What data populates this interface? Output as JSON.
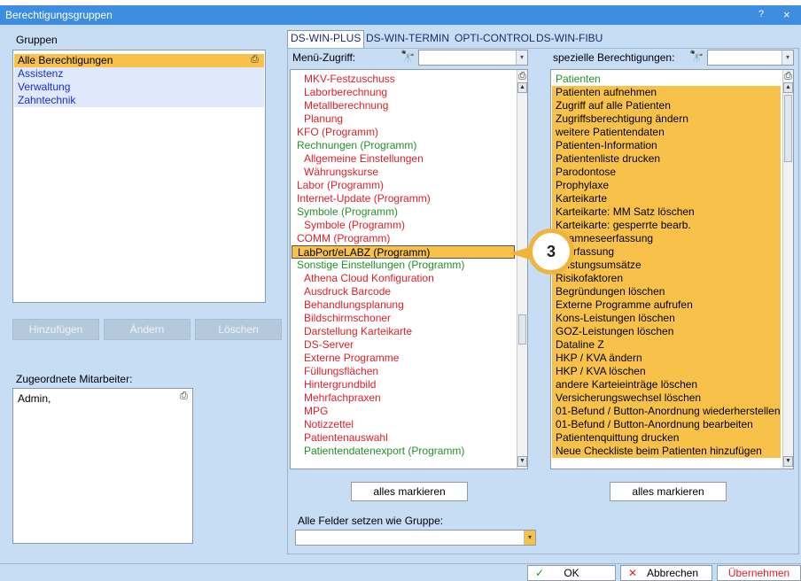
{
  "window": {
    "title": "Berechtigungsgruppen",
    "help": "?",
    "close": "×"
  },
  "groups": {
    "label": "Gruppen",
    "items": [
      "Alle Berechtigungen",
      "Assistenz",
      "Verwaltung",
      "Zahntechnik"
    ],
    "buttons": {
      "add": "Hinzufügen",
      "edit": "Ändern",
      "delete": "Löschen"
    }
  },
  "employees": {
    "label": "Zugeordnete Mitarbeiter:",
    "items": [
      "Admin,"
    ]
  },
  "tabs": [
    "DS-WIN-PLUS",
    "DS-WIN-TERMIN",
    "OPTI-CONTROL",
    "DS-WIN-FIBU"
  ],
  "menu_access": {
    "label": "Menü-Zugriff:",
    "search_value": "",
    "items": [
      {
        "text": "MKV-Festzuschuss",
        "color": "red",
        "indent": true
      },
      {
        "text": "Laborberechnung",
        "color": "red",
        "indent": true
      },
      {
        "text": "Metallberechnung",
        "color": "red",
        "indent": true
      },
      {
        "text": "Planung",
        "color": "red",
        "indent": true
      },
      {
        "text": "KFO (Programm)",
        "color": "red",
        "indent": false
      },
      {
        "text": "Rechnungen (Programm)",
        "color": "green",
        "indent": false
      },
      {
        "text": "Allgemeine Einstellungen",
        "color": "red",
        "indent": true
      },
      {
        "text": "Währungskurse",
        "color": "red",
        "indent": true
      },
      {
        "text": "Labor (Programm)",
        "color": "red",
        "indent": false
      },
      {
        "text": "Internet-Update (Programm)",
        "color": "red",
        "indent": false
      },
      {
        "text": "Symbole (Programm)",
        "color": "green",
        "indent": false
      },
      {
        "text": "Symbole (Programm)",
        "color": "red",
        "indent": true
      },
      {
        "text": "COMM (Programm)",
        "color": "red",
        "indent": false
      },
      {
        "text": "LabPort/eLABZ (Programm)",
        "color": "black",
        "indent": false,
        "selected": true
      },
      {
        "text": "Sonstige Einstellungen (Programm)",
        "color": "green",
        "indent": false
      },
      {
        "text": "Athena Cloud Konfiguration",
        "color": "red",
        "indent": true
      },
      {
        "text": "Ausdruck Barcode",
        "color": "red",
        "indent": true
      },
      {
        "text": "Behandlungsplanung",
        "color": "red",
        "indent": true
      },
      {
        "text": "Bildschirmschoner",
        "color": "red",
        "indent": true
      },
      {
        "text": "Darstellung Karteikarte",
        "color": "red",
        "indent": true
      },
      {
        "text": "DS-Server",
        "color": "red",
        "indent": true
      },
      {
        "text": "Externe Programme",
        "color": "red",
        "indent": true
      },
      {
        "text": "Füllungsflächen",
        "color": "red",
        "indent": true
      },
      {
        "text": "Hintergrundbild",
        "color": "red",
        "indent": true
      },
      {
        "text": "Mehrfachpraxen",
        "color": "red",
        "indent": true
      },
      {
        "text": "MPG",
        "color": "red",
        "indent": true
      },
      {
        "text": "Notizzettel",
        "color": "red",
        "indent": true
      },
      {
        "text": "Patientenauswahl",
        "color": "red",
        "indent": true
      },
      {
        "text": "Patientendatenexport (Programm)",
        "color": "green",
        "indent": true
      }
    ],
    "mark_all": "alles markieren"
  },
  "special_rights": {
    "label": "spezielle Berechtigungen:",
    "search_value": "",
    "header": "Patienten",
    "items": [
      "Patienten aufnehmen",
      "Zugriff auf alle Patienten",
      "Zugriffsberechtigung ändern",
      "weitere Patientendaten",
      "Patienten-Information",
      "Patientenliste drucken",
      "Parodontose",
      "Prophylaxe",
      "Karteikarte",
      "Karteikarte: MM Satz löschen",
      "Karteikarte: gesperrte bearb.",
      "Anamneseerfassung",
      "Leerfassung",
      "Leistungsumsätze",
      "Risikofaktoren",
      "Begründungen löschen",
      "Externe Programme aufrufen",
      "Kons-Leistungen löschen",
      "GOZ-Leistungen löschen",
      "Dataline Z",
      "HKP / KVA ändern",
      "HKP / KVA löschen",
      "andere Karteieinträge löschen",
      "Versicherungswechsel löschen",
      "01-Befund / Button-Anordnung wiederherstellen",
      "01-Befund / Button-Anordnung bearbeiten",
      "Patientenquittung drucken",
      "Neue Checkliste beim Patienten hinzufügen"
    ],
    "mark_all": "alles markieren"
  },
  "set_all": {
    "label": "Alle Felder setzen wie Gruppe:",
    "value": ""
  },
  "footer": {
    "ok": "OK",
    "cancel": "Abbrechen",
    "apply": "Übernehmen"
  },
  "callout": {
    "number": "3"
  },
  "colors": {
    "titlebar": "#3d8ee0",
    "client": "#c6ddf4",
    "selection": "#f8c24a",
    "red": "#e0202a",
    "green": "#22912c"
  }
}
